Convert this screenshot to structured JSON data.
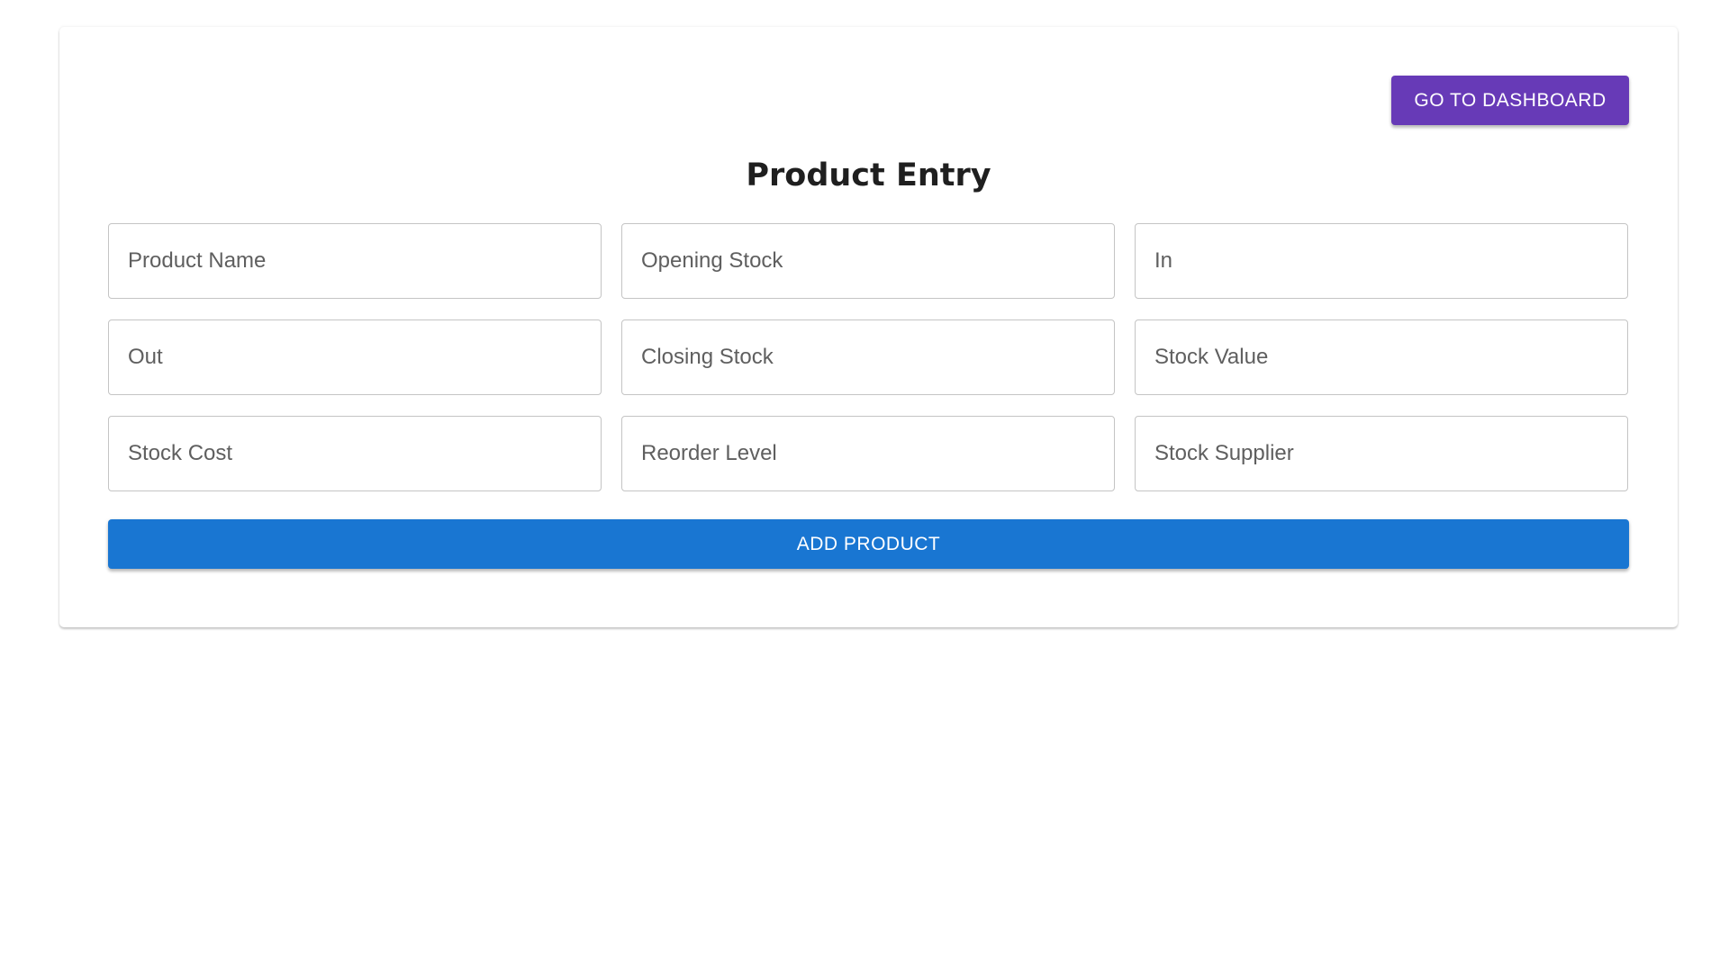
{
  "header": {
    "dashboard_button_label": "GO TO DASHBOARD",
    "title": "Product Entry"
  },
  "form": {
    "fields": [
      {
        "label": "Product Name"
      },
      {
        "label": "Opening Stock"
      },
      {
        "label": "In"
      },
      {
        "label": "Out"
      },
      {
        "label": "Closing Stock"
      },
      {
        "label": "Stock Value"
      },
      {
        "label": "Stock Cost"
      },
      {
        "label": "Reorder Level"
      },
      {
        "label": "Stock Supplier"
      }
    ],
    "submit_label": "ADD PRODUCT"
  },
  "colors": {
    "dashboard_button": "#673ab7",
    "primary_button": "#1976d2"
  }
}
